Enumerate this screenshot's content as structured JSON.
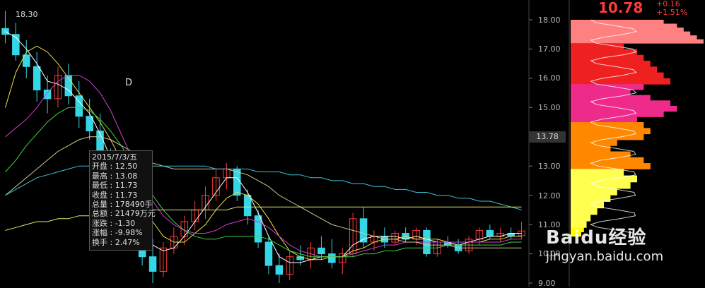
{
  "header": {
    "price": "10.78",
    "change": "+0.16",
    "change_pct": "+1.51%",
    "top_left_label": "18.30",
    "marker_d": "D"
  },
  "axis": {
    "y_ticks": [
      "18.00",
      "17.00",
      "16.00",
      "15.00",
      "14.00",
      "13.00",
      "12.00",
      "11.00",
      "10.00",
      "9.00"
    ],
    "current_price_tag": "13.78"
  },
  "tooltip": {
    "date": "2015/7/3/五",
    "lines": [
      "开盘 : 12.50",
      "最高 : 13.08",
      "最低 : 11.73",
      "收盘 : 11.73",
      "总量 : 178490手",
      "总额 : 21479万元",
      "涨跌 : -1.30",
      "涨幅 : -9.98%",
      "换手 : 2.47%"
    ]
  },
  "watermark": {
    "brand": "Baidu经验",
    "url": "jingyan.baidu.com"
  },
  "colors": {
    "up": "#ff3b3b",
    "down": "#35d6e6",
    "ma1": "#ffffff",
    "ma2": "#f0e040",
    "ma3": "#d040d0",
    "ma4": "#40d040",
    "ma5": "#cccc88",
    "ma6": "#40c0d8"
  },
  "chart_data": {
    "type": "candlestick",
    "ylim": [
      9.0,
      18.5
    ],
    "candles": [
      {
        "o": 17.7,
        "h": 18.3,
        "l": 17.2,
        "c": 17.5
      },
      {
        "o": 17.5,
        "h": 17.9,
        "l": 16.6,
        "c": 16.8
      },
      {
        "o": 16.8,
        "h": 17.3,
        "l": 16.0,
        "c": 16.4
      },
      {
        "o": 16.4,
        "h": 16.9,
        "l": 15.2,
        "c": 15.6
      },
      {
        "o": 15.6,
        "h": 16.1,
        "l": 14.8,
        "c": 15.3
      },
      {
        "o": 15.3,
        "h": 16.4,
        "l": 15.0,
        "c": 16.1
      },
      {
        "o": 16.1,
        "h": 16.5,
        "l": 15.1,
        "c": 15.4
      },
      {
        "o": 15.4,
        "h": 15.9,
        "l": 14.3,
        "c": 14.7
      },
      {
        "o": 14.7,
        "h": 15.3,
        "l": 13.9,
        "c": 14.2
      },
      {
        "o": 14.2,
        "h": 14.8,
        "l": 12.9,
        "c": 13.3
      },
      {
        "o": 13.3,
        "h": 13.6,
        "l": 11.9,
        "c": 12.2
      },
      {
        "o": 12.5,
        "h": 13.08,
        "l": 11.73,
        "c": 11.73
      },
      {
        "o": 11.7,
        "h": 12.0,
        "l": 10.6,
        "c": 10.9
      },
      {
        "o": 10.9,
        "h": 11.2,
        "l": 9.6,
        "c": 9.9
      },
      {
        "o": 9.9,
        "h": 10.5,
        "l": 9.0,
        "c": 9.4
      },
      {
        "o": 9.4,
        "h": 10.4,
        "l": 9.2,
        "c": 10.2
      },
      {
        "o": 10.2,
        "h": 10.9,
        "l": 10.0,
        "c": 10.6
      },
      {
        "o": 10.6,
        "h": 11.3,
        "l": 10.3,
        "c": 11.1
      },
      {
        "o": 11.1,
        "h": 11.8,
        "l": 10.8,
        "c": 11.5
      },
      {
        "o": 11.5,
        "h": 12.3,
        "l": 11.2,
        "c": 12.0
      },
      {
        "o": 12.0,
        "h": 12.9,
        "l": 11.8,
        "c": 12.6
      },
      {
        "o": 12.6,
        "h": 13.1,
        "l": 12.2,
        "c": 12.9
      },
      {
        "o": 12.9,
        "h": 13.0,
        "l": 11.8,
        "c": 12.0
      },
      {
        "o": 12.0,
        "h": 12.2,
        "l": 11.0,
        "c": 11.3
      },
      {
        "o": 11.3,
        "h": 11.5,
        "l": 10.2,
        "c": 10.4
      },
      {
        "o": 10.4,
        "h": 10.6,
        "l": 9.3,
        "c": 9.6
      },
      {
        "o": 9.6,
        "h": 10.0,
        "l": 9.0,
        "c": 9.3
      },
      {
        "o": 9.3,
        "h": 10.1,
        "l": 9.1,
        "c": 9.9
      },
      {
        "o": 9.9,
        "h": 10.3,
        "l": 9.6,
        "c": 9.8
      },
      {
        "o": 9.8,
        "h": 10.4,
        "l": 9.5,
        "c": 10.2
      },
      {
        "o": 10.2,
        "h": 10.6,
        "l": 9.8,
        "c": 10.0
      },
      {
        "o": 10.0,
        "h": 10.5,
        "l": 9.5,
        "c": 9.7
      },
      {
        "o": 9.7,
        "h": 10.2,
        "l": 9.3,
        "c": 10.0
      },
      {
        "o": 10.0,
        "h": 11.4,
        "l": 9.9,
        "c": 11.2
      },
      {
        "o": 11.2,
        "h": 11.6,
        "l": 10.2,
        "c": 10.4
      },
      {
        "o": 10.4,
        "h": 10.8,
        "l": 10.1,
        "c": 10.6
      },
      {
        "o": 10.6,
        "h": 10.9,
        "l": 10.2,
        "c": 10.4
      },
      {
        "o": 10.4,
        "h": 10.8,
        "l": 10.3,
        "c": 10.7
      },
      {
        "o": 10.7,
        "h": 10.9,
        "l": 10.4,
        "c": 10.5
      },
      {
        "o": 10.5,
        "h": 10.9,
        "l": 10.3,
        "c": 10.8
      },
      {
        "o": 10.8,
        "h": 10.9,
        "l": 9.9,
        "c": 10.0
      },
      {
        "o": 10.0,
        "h": 10.5,
        "l": 9.9,
        "c": 10.4
      },
      {
        "o": 10.4,
        "h": 10.6,
        "l": 10.2,
        "c": 10.3
      },
      {
        "o": 10.3,
        "h": 10.5,
        "l": 10.0,
        "c": 10.1
      },
      {
        "o": 10.1,
        "h": 10.6,
        "l": 10.0,
        "c": 10.5
      },
      {
        "o": 10.5,
        "h": 10.9,
        "l": 10.3,
        "c": 10.8
      },
      {
        "o": 10.8,
        "h": 11.0,
        "l": 10.5,
        "c": 10.6
      },
      {
        "o": 10.6,
        "h": 10.9,
        "l": 10.4,
        "c": 10.7
      },
      {
        "o": 10.7,
        "h": 10.9,
        "l": 10.5,
        "c": 10.6
      },
      {
        "o": 10.62,
        "h": 11.1,
        "l": 10.5,
        "c": 10.78
      }
    ],
    "ma_lines": [
      {
        "name": "ma1",
        "values": [
          17.6,
          17.4,
          17.0,
          16.5,
          15.9,
          15.8,
          15.6,
          15.2,
          14.8,
          14.1,
          13.3,
          12.5,
          11.6,
          10.9,
          10.3,
          10.1,
          10.2,
          10.6,
          11.1,
          11.6,
          12.1,
          12.6,
          12.6,
          12.1,
          11.4,
          10.6,
          9.9,
          9.7,
          9.7,
          9.8,
          9.9,
          9.9,
          9.9,
          10.3,
          10.5,
          10.6,
          10.6,
          10.6,
          10.5,
          10.6,
          10.5,
          10.4,
          10.4,
          10.3,
          10.4,
          10.5,
          10.6,
          10.6,
          10.7,
          10.7
        ]
      },
      {
        "name": "ma2",
        "values": [
          15.0,
          16.2,
          16.9,
          17.1,
          16.9,
          16.5,
          16.0,
          15.5,
          15.0,
          14.5,
          13.9,
          13.2,
          12.5,
          11.8,
          11.1,
          10.6,
          10.4,
          10.4,
          10.7,
          11.0,
          11.5,
          11.9,
          12.1,
          12.0,
          11.7,
          11.2,
          10.6,
          10.1,
          9.9,
          9.8,
          9.8,
          9.9,
          9.9,
          10.1,
          10.2,
          10.4,
          10.5,
          10.5,
          10.6,
          10.5,
          10.5,
          10.5,
          10.4,
          10.4,
          10.4,
          10.4,
          10.5,
          10.5,
          10.6,
          10.6
        ]
      },
      {
        "name": "ma3",
        "values": [
          14.0,
          14.3,
          14.6,
          15.0,
          15.5,
          15.9,
          16.1,
          16.1,
          15.9,
          15.5,
          14.9,
          14.1,
          13.3,
          12.5,
          11.8,
          11.3,
          11.0,
          10.8,
          10.7,
          10.7,
          10.8,
          11.0,
          11.1,
          11.2,
          11.1,
          10.9,
          10.6,
          10.3,
          10.1,
          10.0,
          9.9,
          9.9,
          9.9,
          10.0,
          10.1,
          10.2,
          10.3,
          10.3,
          10.4,
          10.4,
          10.4,
          10.4,
          10.4,
          10.4,
          10.4,
          10.4,
          10.4,
          10.4,
          10.5,
          10.5
        ]
      },
      {
        "name": "ma4",
        "values": [
          12.8,
          13.2,
          13.7,
          14.1,
          14.5,
          14.8,
          15.0,
          15.0,
          14.9,
          14.6,
          14.2,
          13.7,
          13.1,
          12.5,
          12.0,
          11.5,
          11.1,
          10.8,
          10.6,
          10.5,
          10.5,
          10.6,
          10.6,
          10.6,
          10.6,
          10.5,
          10.3,
          10.1,
          10.0,
          9.9,
          9.9,
          9.9,
          9.9,
          9.9,
          10.0,
          10.0,
          10.1,
          10.1,
          10.2,
          10.2,
          10.2,
          10.2,
          10.3,
          10.3,
          10.3,
          10.3,
          10.3,
          10.3,
          10.4,
          10.4
        ]
      },
      {
        "name": "ma5",
        "values": [
          12.0,
          12.3,
          12.6,
          12.9,
          13.2,
          13.5,
          13.7,
          13.9,
          14.0,
          14.0,
          13.9,
          13.7,
          13.5,
          13.3,
          13.1,
          13.0,
          12.9,
          12.9,
          12.9,
          12.9,
          12.9,
          12.9,
          12.8,
          12.7,
          12.5,
          12.3,
          12.0,
          11.8,
          11.6,
          11.4,
          11.2,
          11.0,
          10.9,
          10.8,
          10.7,
          10.6,
          10.5,
          10.5,
          10.4,
          10.4,
          10.3,
          10.3,
          10.3,
          10.2,
          10.2,
          10.2,
          10.2,
          10.2,
          10.2,
          10.2
        ]
      },
      {
        "name": "ma6",
        "values": [
          12.0,
          12.2,
          12.4,
          12.6,
          12.7,
          12.8,
          12.9,
          13.0,
          13.0,
          13.0,
          13.0,
          13.0,
          13.0,
          13.0,
          13.0,
          13.0,
          13.0,
          13.0,
          13.0,
          13.0,
          12.9,
          12.9,
          12.9,
          12.9,
          12.8,
          12.8,
          12.8,
          12.7,
          12.7,
          12.6,
          12.6,
          12.5,
          12.5,
          12.4,
          12.4,
          12.3,
          12.3,
          12.2,
          12.2,
          12.1,
          12.1,
          12.0,
          12.0,
          11.9,
          11.9,
          11.8,
          11.8,
          11.7,
          11.6,
          11.5
        ]
      },
      {
        "name": "ma7",
        "values": [
          10.8,
          10.9,
          11.0,
          11.1,
          11.1,
          11.2,
          11.2,
          11.3,
          11.3,
          11.3,
          11.4,
          11.4,
          11.4,
          11.4,
          11.5,
          11.5,
          11.5,
          11.5,
          11.5,
          11.5,
          11.5,
          11.5,
          11.6,
          11.6,
          11.6,
          11.6,
          11.6,
          11.6,
          11.6,
          11.6,
          11.6,
          11.6,
          11.6,
          11.6,
          11.6,
          11.6,
          11.6,
          11.6,
          11.6,
          11.6,
          11.6,
          11.6,
          11.6,
          11.6,
          11.6,
          11.6,
          11.6,
          11.6,
          11.6,
          11.6
        ]
      }
    ],
    "cost_distribution": {
      "bands": [
        {
          "name": "band-1",
          "color": "#ff8080",
          "from": 17.2,
          "to": 18.0,
          "profile": [
            0.7,
            0.8,
            0.85,
            0.9,
            0.95,
            1.0
          ]
        },
        {
          "name": "band-2",
          "color": "#ee2020",
          "from": 15.8,
          "to": 17.2,
          "profile": [
            0.4,
            0.5,
            0.55,
            0.6,
            0.65,
            0.7,
            0.75
          ]
        },
        {
          "name": "band-3",
          "color": "#ee2a8a",
          "from": 14.5,
          "to": 15.8,
          "profile": [
            0.55,
            0.45,
            0.6,
            0.75,
            0.8,
            0.7,
            0.5
          ]
        },
        {
          "name": "band-4",
          "color": "#ff8800",
          "from": 12.9,
          "to": 14.5,
          "profile": [
            0.55,
            0.6,
            0.55,
            0.35,
            0.3,
            0.45,
            0.55,
            0.6
          ]
        },
        {
          "name": "band-5",
          "color": "#ffff50",
          "from": 10.9,
          "to": 12.9,
          "profile": [
            0.4,
            0.5,
            0.45,
            0.35,
            0.3,
            0.25,
            0.2,
            0.15,
            0.12
          ]
        },
        {
          "name": "band-6",
          "color": "#ffff00",
          "from": 10.6,
          "to": 10.9,
          "profile": [
            0.1,
            0.08
          ]
        }
      ]
    }
  }
}
